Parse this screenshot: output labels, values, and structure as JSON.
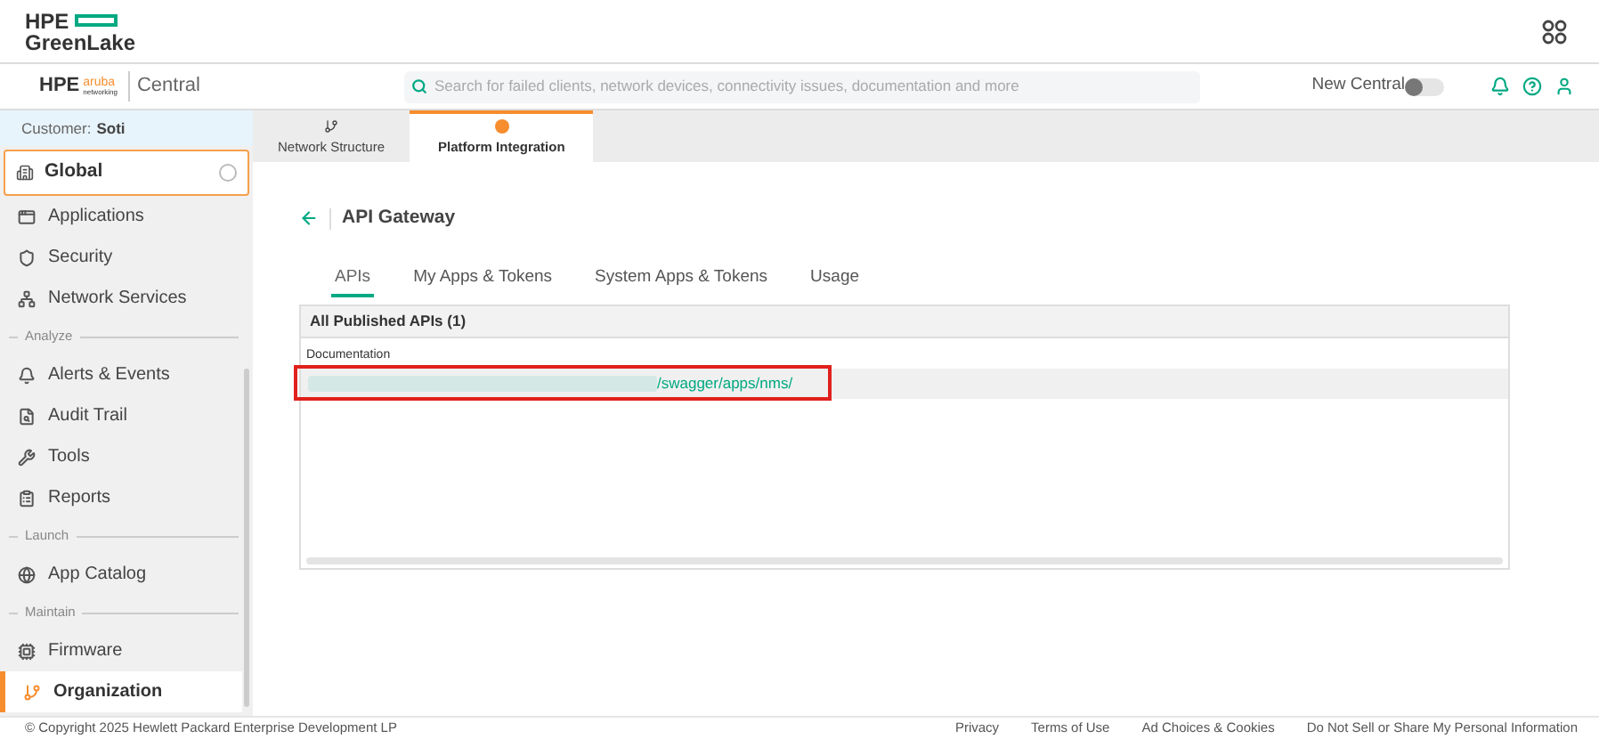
{
  "header": {
    "brand_line_1": "HPE",
    "brand_line_2": "GreenLake"
  },
  "topbar": {
    "logo_text": "HPE",
    "logo_sub": "aruba",
    "logo_sub_2": "networking",
    "product": "Central",
    "search": {
      "placeholder": "Search for failed clients, network devices, connectivity issues, documentation and more"
    },
    "new_central": {
      "label": "New Central",
      "on": false
    }
  },
  "sidebar": {
    "customer_label": "Customer:",
    "customer": "Soti",
    "scope": {
      "label": "Global"
    },
    "items": [
      {
        "kind": "item",
        "label": "Applications",
        "selected": false
      },
      {
        "kind": "item",
        "label": "Security",
        "selected": false
      },
      {
        "kind": "item",
        "label": "Network Services",
        "selected": false
      },
      {
        "kind": "section",
        "label": "Analyze"
      },
      {
        "kind": "item",
        "label": "Alerts & Events",
        "selected": false
      },
      {
        "kind": "item",
        "label": "Audit Trail",
        "selected": false
      },
      {
        "kind": "item",
        "label": "Tools",
        "selected": false
      },
      {
        "kind": "item",
        "label": "Reports",
        "selected": false
      },
      {
        "kind": "section",
        "label": "Launch"
      },
      {
        "kind": "item",
        "label": "App Catalog",
        "selected": false
      },
      {
        "kind": "section",
        "label": "Maintain"
      },
      {
        "kind": "item",
        "label": "Firmware",
        "selected": false
      },
      {
        "kind": "item",
        "label": "Organization",
        "selected": true
      }
    ]
  },
  "page_tabs": [
    {
      "label": "Network Structure",
      "selected": false
    },
    {
      "label": "Platform Integration",
      "selected": true
    }
  ],
  "page_title": "API Gateway",
  "tabs": [
    {
      "label": "APIs",
      "selected": true
    },
    {
      "label": "My Apps & Tokens",
      "selected": false
    },
    {
      "label": "System Apps & Tokens",
      "selected": false
    },
    {
      "label": "Usage",
      "selected": false
    }
  ],
  "table": {
    "title": "All Published APIs (1)",
    "columns": [
      "Documentation"
    ],
    "rows": [
      {
        "link": "/swagger/apps/nms/"
      }
    ]
  },
  "footer": {
    "copyright": "© Copyright 2025 Hewlett Packard Enterprise Development LP",
    "links": [
      "Privacy",
      "Terms of Use",
      "Ad Choices & Cookies",
      "Do Not Sell or Share My Personal Information"
    ]
  }
}
